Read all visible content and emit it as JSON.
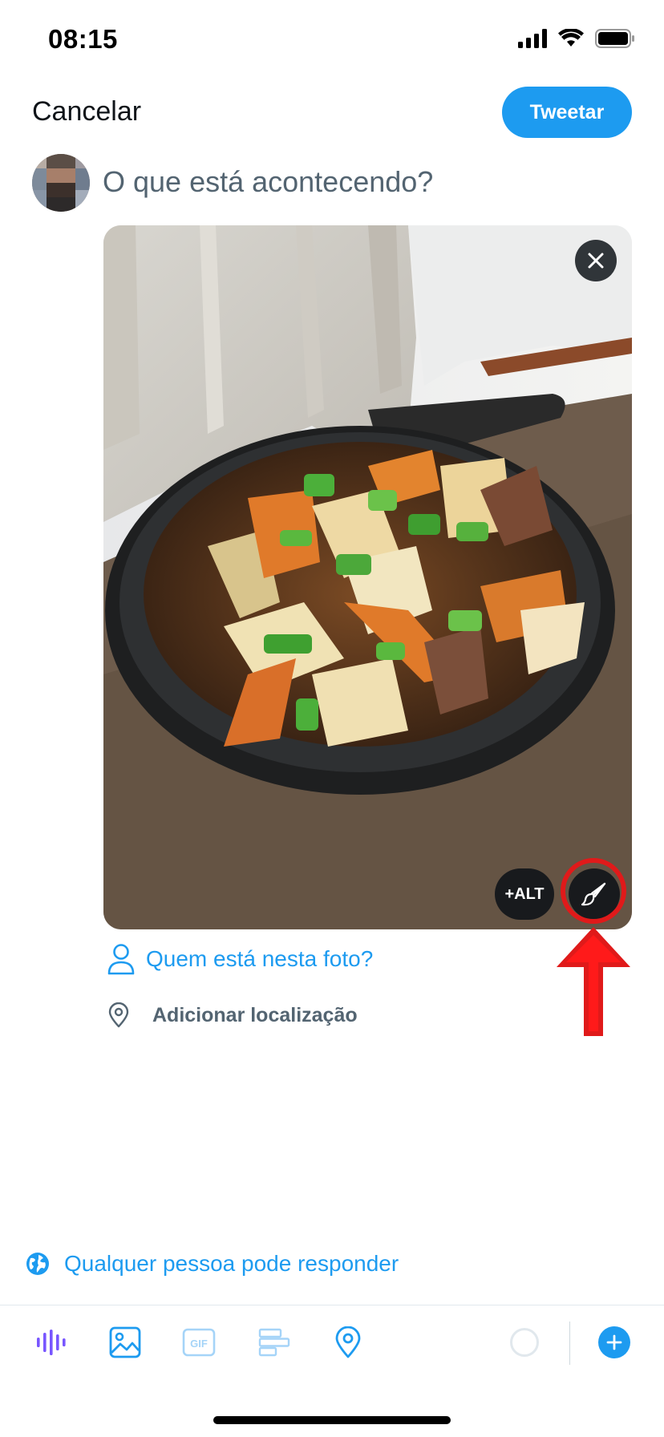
{
  "status_bar": {
    "time": "08:15"
  },
  "header": {
    "cancel_label": "Cancelar",
    "tweet_label": "Tweetar"
  },
  "composer": {
    "placeholder": "O que está acontecendo?"
  },
  "media": {
    "alt_label": "+ALT"
  },
  "options": {
    "tag_people": "Quem está nesta foto?",
    "add_location": "Adicionar localização"
  },
  "reply_setting": {
    "label": "Qualquer pessoa pode responder"
  },
  "toolbar": {
    "icons": [
      "voice-icon",
      "image-icon",
      "gif-icon",
      "poll-icon",
      "location-icon"
    ]
  },
  "colors": {
    "accent": "#1d9bf0",
    "annotation": "#e01a1a",
    "voice": "#7856ff"
  }
}
